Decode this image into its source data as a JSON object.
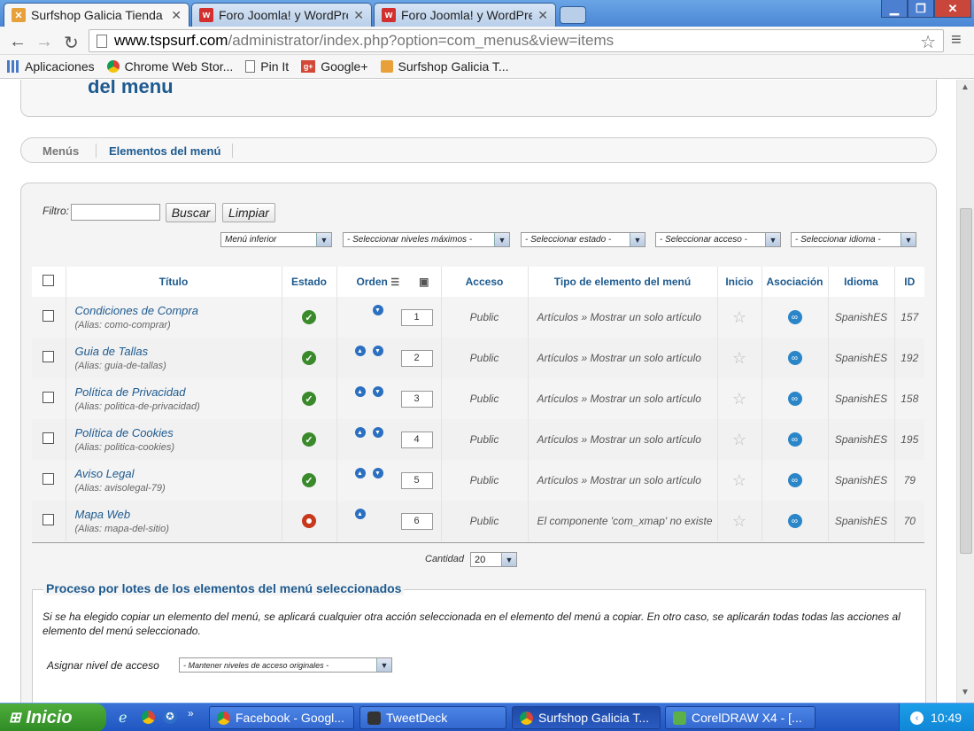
{
  "browser": {
    "tabs": [
      {
        "label": "Surfshop Galicia Tienda",
        "active": true
      },
      {
        "label": "Foro Joomla! y WordPre",
        "active": false
      },
      {
        "label": "Foro Joomla! y WordPre",
        "active": false
      }
    ],
    "url_host": "www.tspsurf.com",
    "url_path": "/administrator/index.php?option=com_menus&view=items",
    "bookmarks": [
      "Aplicaciones",
      "Chrome Web Stor...",
      "Pin It",
      "Google+",
      "Surfshop Galicia T..."
    ]
  },
  "page": {
    "heading": "del menu",
    "subnav": [
      "Menús",
      "Elementos del menú"
    ],
    "filter": {
      "label": "Filtro:",
      "value": "",
      "search_button": "Buscar",
      "clear_button": "Limpiar"
    },
    "selects": [
      "Menú inferior",
      "- Seleccionar niveles máximos -",
      "- Seleccionar estado -",
      "- Seleccionar acceso -",
      "- Seleccionar idioma -"
    ],
    "columns": {
      "title": "Título",
      "status": "Estado",
      "order": "Orden",
      "access": "Acceso",
      "type": "Tipo de elemento del menú",
      "home": "Inicio",
      "association": "Asociación",
      "language": "Idioma",
      "id": "ID"
    },
    "rows": [
      {
        "title": "Condiciones de Compra",
        "alias_label": "(Alias:",
        "alias": "como-comprar)",
        "published": true,
        "up": false,
        "down": true,
        "order": "1",
        "access": "Public",
        "type": "Artículos » Mostrar un solo artículo",
        "language": "SpanishES",
        "id": "157"
      },
      {
        "title": "Guia de Tallas",
        "alias_label": "(Alias:",
        "alias": "guia-de-tallas)",
        "published": true,
        "up": true,
        "down": true,
        "order": "2",
        "access": "Public",
        "type": "Artículos » Mostrar un solo artículo",
        "language": "SpanishES",
        "id": "192"
      },
      {
        "title": "Política de Privacidad",
        "alias_label": "(Alias:",
        "alias": "politica-de-privacidad)",
        "published": true,
        "up": true,
        "down": true,
        "order": "3",
        "access": "Public",
        "type": "Artículos » Mostrar un solo artículo",
        "language": "SpanishES",
        "id": "158"
      },
      {
        "title": "Política de Cookies",
        "alias_label": "(Alias:",
        "alias": "politica-cookies)",
        "published": true,
        "up": true,
        "down": true,
        "order": "4",
        "access": "Public",
        "type": "Artículos » Mostrar un solo artículo",
        "language": "SpanishES",
        "id": "195"
      },
      {
        "title": "Aviso Legal",
        "alias_label": "(Alias:",
        "alias": "avisolegal-79)",
        "published": true,
        "up": true,
        "down": true,
        "order": "5",
        "access": "Public",
        "type": "Artículos » Mostrar un solo artículo",
        "language": "SpanishES",
        "id": "79"
      },
      {
        "title": "Mapa Web",
        "alias_label": "(Alias:",
        "alias": "mapa-del-sitio)",
        "published": false,
        "up": true,
        "down": false,
        "order": "6",
        "access": "Public",
        "type": "El componente 'com_xmap' no existe",
        "language": "SpanishES",
        "id": "70"
      }
    ],
    "pagination": {
      "label": "Cantidad",
      "value": "20"
    },
    "batch": {
      "title": "Proceso por lotes de los elementos del menú seleccionados",
      "description": "Si se ha elegido copiar un elemento del menú, se aplicará cualquier otra acción seleccionada en el elemento del menú a copiar. En otro caso, se aplicarán todas todas las acciones al elemento del menú seleccionado.",
      "access_label": "Asignar nivel de acceso",
      "access_select": "- Mantener niveles de acceso originales -"
    }
  },
  "taskbar": {
    "start": "Inicio",
    "tasks": [
      "Facebook - Googl...",
      "TweetDeck",
      "Surfshop Galicia T...",
      "CorelDRAW X4 - [..."
    ],
    "clock": "10:49"
  }
}
